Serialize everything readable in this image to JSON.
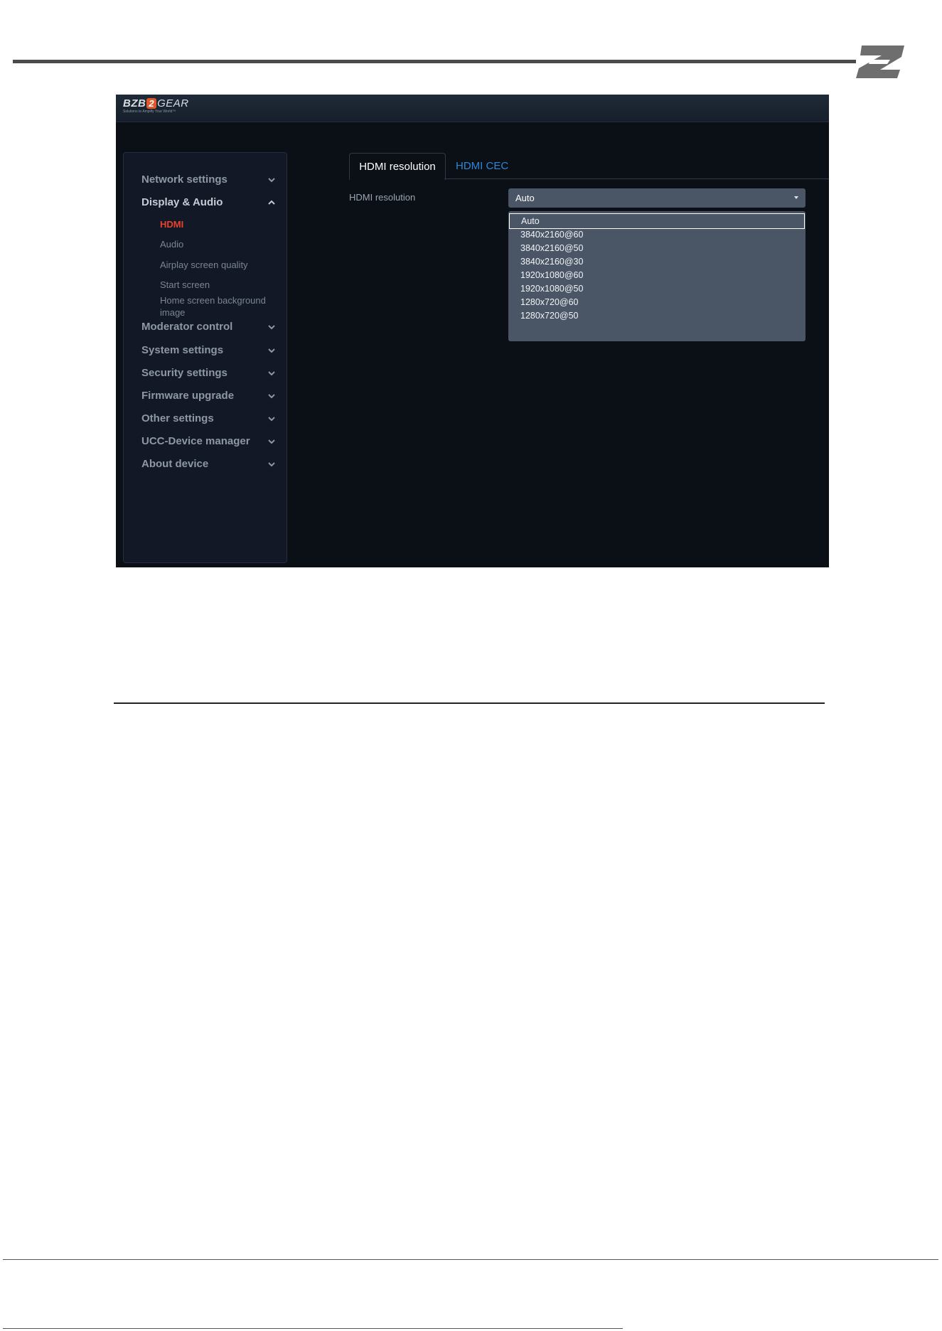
{
  "app": {
    "brand_prefix": "BZB",
    "brand_mark": "2",
    "brand_suffix": "GEAR",
    "tagline": "Solutions to Amplify Your World™"
  },
  "sidebar": {
    "items": [
      {
        "label": "Network settings",
        "expanded": false
      },
      {
        "label": "Display & Audio",
        "expanded": true,
        "children": [
          {
            "label": "HDMI",
            "active": true
          },
          {
            "label": "Audio"
          },
          {
            "label": "Airplay screen quality"
          },
          {
            "label": "Start screen"
          },
          {
            "label": "Home screen background image"
          }
        ]
      },
      {
        "label": "Moderator control",
        "expanded": false
      },
      {
        "label": "System settings",
        "expanded": false
      },
      {
        "label": "Security settings",
        "expanded": false
      },
      {
        "label": "Firmware upgrade",
        "expanded": false
      },
      {
        "label": "Other settings",
        "expanded": false
      },
      {
        "label": "UCC-Device manager",
        "expanded": false
      },
      {
        "label": "About device",
        "expanded": false
      }
    ]
  },
  "tabs": [
    {
      "label": "HDMI resolution",
      "active": true
    },
    {
      "label": "HDMI CEC",
      "active": false
    }
  ],
  "form": {
    "resolution_label": "HDMI resolution",
    "resolution_value": "Auto",
    "options": [
      "Auto",
      "3840x2160@60",
      "3840x2160@50",
      "3840x2160@30",
      "1920x1080@60",
      "1920x1080@50",
      "1280x720@60",
      "1280x720@50"
    ],
    "selected_option": "Auto"
  },
  "colors": {
    "background": "#0b1017",
    "accent_active": "#e8432a",
    "tab_link": "#2f86d6",
    "select_bg": "#4a5666"
  }
}
